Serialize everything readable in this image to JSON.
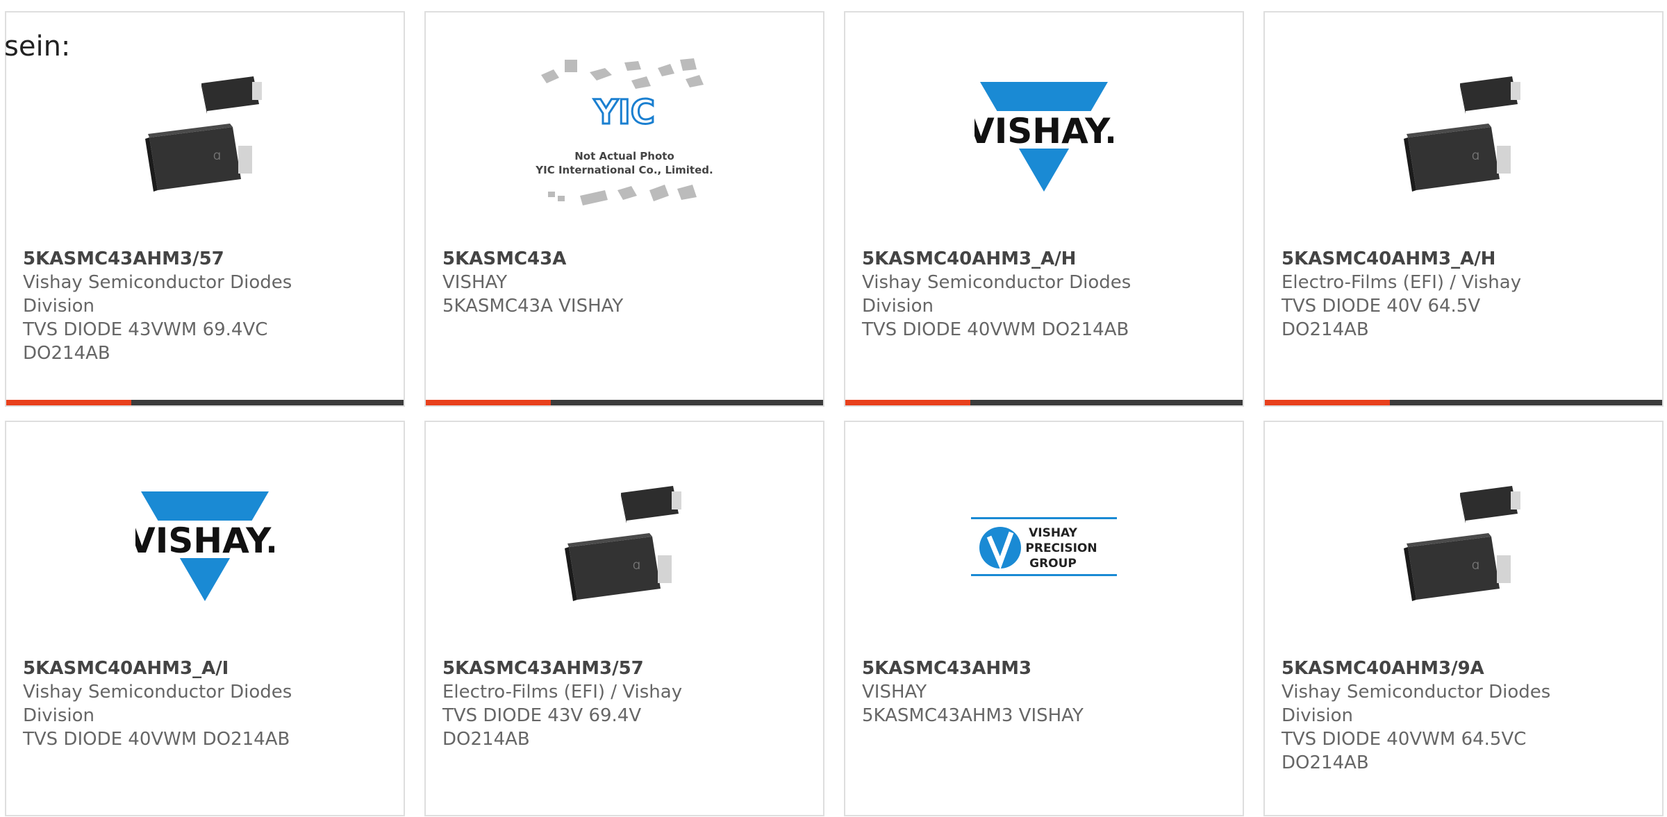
{
  "intro_text": "sein:",
  "colors": {
    "accent": "#e8401c",
    "bar_dark": "#3b3b3b",
    "vishay_blue": "#1a8ad4"
  },
  "cards": [
    {
      "part": "5KASMC43AHM3/57",
      "mfr": "Vishay Semiconductor Diodes Division",
      "desc": "TVS DIODE 43VWM 69.4VC DO214AB",
      "image": "smc-diode-photo"
    },
    {
      "part": "5KASMC43A",
      "mfr": "VISHAY",
      "desc": "5KASMC43A VISHAY",
      "image": "yic-placeholder",
      "img_text1": "Not Actual Photo",
      "img_text2": "YIC International Co., Limited."
    },
    {
      "part": "5KASMC40AHM3_A/H",
      "mfr": "Vishay Semiconductor Diodes Division",
      "desc": "TVS DIODE 40VWM DO214AB",
      "image": "vishay-logo",
      "logo_text": "VISHAY."
    },
    {
      "part": "5KASMC40AHM3_A/H",
      "mfr": "Electro-Films (EFI) / Vishay",
      "desc": "TVS DIODE 40V 64.5V DO214AB",
      "image": "smc-diode-photo"
    },
    {
      "part": "5KASMC40AHM3_A/I",
      "mfr": "Vishay Semiconductor Diodes Division",
      "desc": "TVS DIODE 40VWM DO214AB",
      "image": "vishay-logo",
      "logo_text": "VISHAY."
    },
    {
      "part": "5KASMC43AHM3/57",
      "mfr": "Electro-Films (EFI) / Vishay",
      "desc": "TVS DIODE 43V 69.4V DO214AB",
      "image": "smc-diode-photo"
    },
    {
      "part": "5KASMC43AHM3",
      "mfr": "VISHAY",
      "desc": "5KASMC43AHM3 VISHAY",
      "image": "vpg-logo",
      "logo_lines": [
        "VISHAY",
        "PRECISION",
        "GROUP"
      ]
    },
    {
      "part": "5KASMC40AHM3/9A",
      "mfr": "Vishay Semiconductor Diodes Division",
      "desc": "TVS DIODE 40VWM 64.5VC DO214AB",
      "image": "smc-diode-photo"
    }
  ]
}
